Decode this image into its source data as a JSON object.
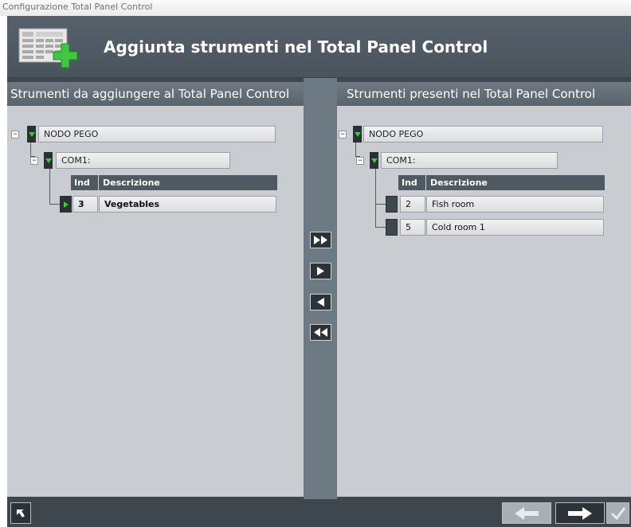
{
  "window": {
    "title": "Configurazione Total Panel Control"
  },
  "header": {
    "title": "Aggiunta strumenti nel Total Panel Control",
    "icon": "panel-add-icon"
  },
  "left_panel": {
    "title": "Strumenti da aggiungere al Total Panel Control",
    "node": {
      "label": "NODO PEGO",
      "expander": "−"
    },
    "port": {
      "label": "COM1:",
      "expander": "−"
    },
    "columns": {
      "ind": "Ind",
      "desc": "Descrizione"
    },
    "rows": [
      {
        "ind": "3",
        "desc": "Vegetables"
      }
    ]
  },
  "right_panel": {
    "title": "Strumenti presenti nel Total Panel Control",
    "node": {
      "label": "NODO PEGO",
      "expander": "−"
    },
    "port": {
      "label": "COM1:",
      "expander": "−"
    },
    "columns": {
      "ind": "Ind",
      "desc": "Descrizione"
    },
    "rows": [
      {
        "ind": "2",
        "desc": "Fish room"
      },
      {
        "ind": "5",
        "desc": "Cold room 1"
      }
    ]
  },
  "transfer_buttons": [
    "move-all-right-icon",
    "move-right-icon",
    "move-left-icon",
    "move-all-left-icon"
  ],
  "footer": {
    "buttons": [
      "undo-icon",
      "back-arrow-icon",
      "forward-arrow-icon",
      "confirm-check-icon"
    ]
  },
  "colors": {
    "header": "#4f5a63",
    "panel": "#c9cdd1",
    "frame": "#3e464e",
    "accent_green": "#3fc83f"
  }
}
